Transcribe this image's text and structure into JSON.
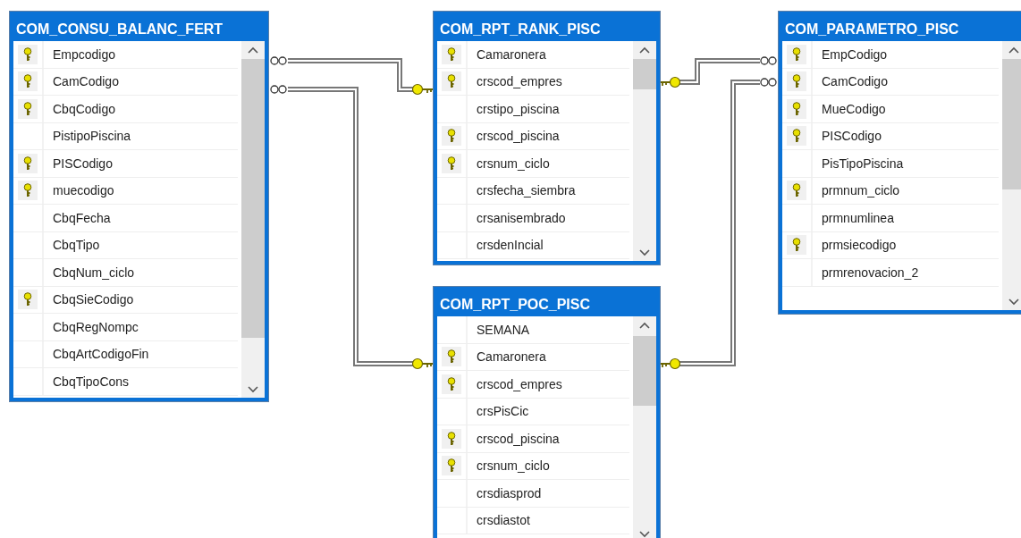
{
  "tables": [
    {
      "title": "COM_CONSU_BALANC_FERT",
      "columns": [
        {
          "name": "Empcodigo",
          "primary_key": true
        },
        {
          "name": "CamCodigo",
          "primary_key": true
        },
        {
          "name": "CbqCodigo",
          "primary_key": true
        },
        {
          "name": "PistipoPiscina",
          "primary_key": false
        },
        {
          "name": "PISCodigo",
          "primary_key": true
        },
        {
          "name": "muecodigo",
          "primary_key": true
        },
        {
          "name": "CbqFecha",
          "primary_key": false
        },
        {
          "name": "CbqTipo",
          "primary_key": false
        },
        {
          "name": "CbqNum_ciclo",
          "primary_key": false
        },
        {
          "name": "CbqSieCodigo",
          "primary_key": true
        },
        {
          "name": "CbqRegNompc",
          "primary_key": false
        },
        {
          "name": "CbqArtCodigoFin",
          "primary_key": false
        },
        {
          "name": "CbqTipoCons",
          "primary_key": false
        }
      ]
    },
    {
      "title": "COM_RPT_RANK_PISC",
      "columns": [
        {
          "name": "Camaronera",
          "primary_key": true
        },
        {
          "name": "crscod_empres",
          "primary_key": true
        },
        {
          "name": "crstipo_piscina",
          "primary_key": false
        },
        {
          "name": "crscod_piscina",
          "primary_key": true
        },
        {
          "name": "crsnum_ciclo",
          "primary_key": true
        },
        {
          "name": "crsfecha_siembra",
          "primary_key": false
        },
        {
          "name": "crsanisembrado",
          "primary_key": false
        },
        {
          "name": "crsdenIncial",
          "primary_key": false
        }
      ]
    },
    {
      "title": "COM_RPT_POC_PISC",
      "columns": [
        {
          "name": "SEMANA",
          "primary_key": false
        },
        {
          "name": "Camaronera",
          "primary_key": true
        },
        {
          "name": "crscod_empres",
          "primary_key": true
        },
        {
          "name": "crsPisCic",
          "primary_key": false
        },
        {
          "name": "crscod_piscina",
          "primary_key": true
        },
        {
          "name": "crsnum_ciclo",
          "primary_key": true
        },
        {
          "name": "crsdiasprod",
          "primary_key": false
        },
        {
          "name": "crsdiastot",
          "primary_key": false
        }
      ]
    },
    {
      "title": "COM_PARAMETRO_PISC",
      "columns": [
        {
          "name": "EmpCodigo",
          "primary_key": true
        },
        {
          "name": "CamCodigo",
          "primary_key": true
        },
        {
          "name": "MueCodigo",
          "primary_key": true
        },
        {
          "name": "PISCodigo",
          "primary_key": true
        },
        {
          "name": "PisTipoPiscina",
          "primary_key": false
        },
        {
          "name": "prmnum_ciclo",
          "primary_key": true
        },
        {
          "name": "prmnumlinea",
          "primary_key": false
        },
        {
          "name": "prmsiecodigo",
          "primary_key": true
        },
        {
          "name": "prmrenovacion_2",
          "primary_key": false
        }
      ]
    }
  ]
}
